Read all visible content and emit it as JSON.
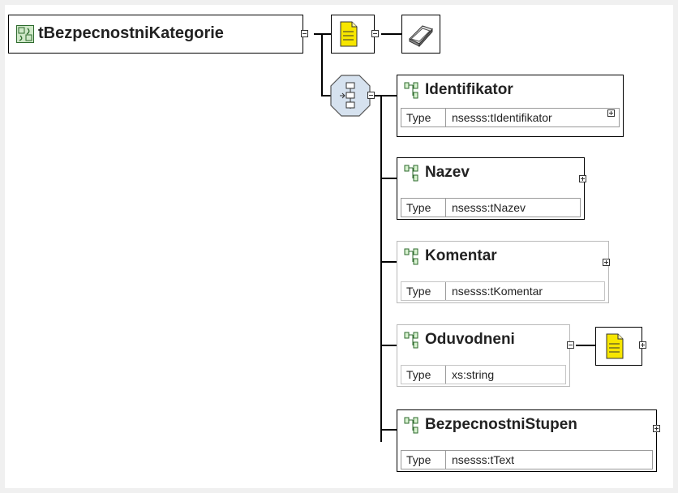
{
  "root": {
    "name": "tBezpecnostniKategorie",
    "icon": "complex-type-icon"
  },
  "annotation": {
    "icon": "annotation-note-icon",
    "doc_icon": "documentation-book-icon"
  },
  "compositor": {
    "icon": "sequence-compositor-icon"
  },
  "elements": [
    {
      "name": "Identifikator",
      "type_label": "Type",
      "type": "nsesss:tIdentifikator",
      "optional": false
    },
    {
      "name": "Nazev",
      "type_label": "Type",
      "type": "nsesss:tNazev",
      "optional": false
    },
    {
      "name": "Komentar",
      "type_label": "Type",
      "type": "nsesss:tKomentar",
      "optional": true
    },
    {
      "name": "Oduvodneni",
      "type_label": "Type",
      "type": "xs:string",
      "optional": true,
      "has_annotation": true
    },
    {
      "name": "BezpecnostniStupen",
      "type_label": "Type",
      "type": "nsesss:tText",
      "optional": false
    }
  ],
  "colors": {
    "note_yellow": "#f7e600",
    "type_green": "#cfe8c8",
    "compositor_fill": "#d6e2ef"
  }
}
